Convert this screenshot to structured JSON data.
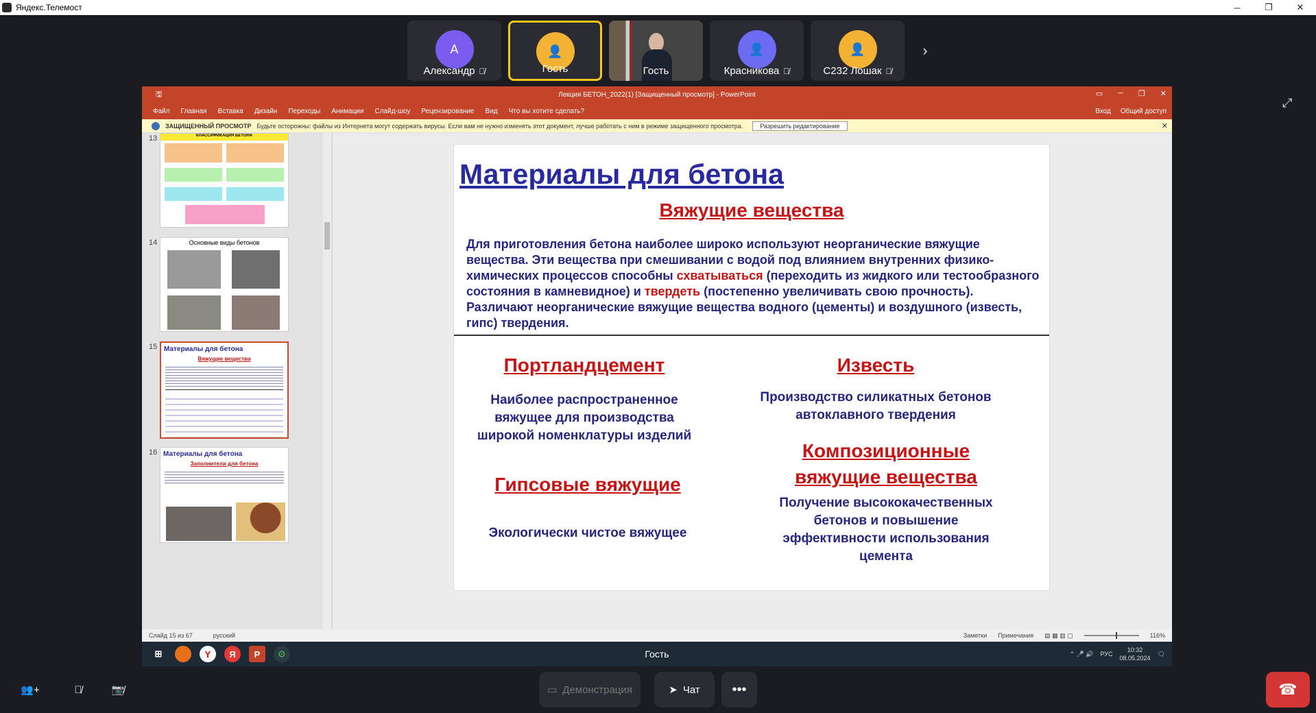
{
  "window": {
    "title": "Яндекс.Телемост"
  },
  "participants": [
    {
      "name": "Александр",
      "initial": "А",
      "color": "#7a5cf0",
      "muted": true
    },
    {
      "name": "Гость",
      "initial": "",
      "color": "#f3b233",
      "muted": false,
      "active": true
    },
    {
      "name": "Гость",
      "initial": "",
      "color": "",
      "muted": false,
      "video": true
    },
    {
      "name": "Красникова",
      "initial": "",
      "color": "#6b6cf2",
      "muted": true
    },
    {
      "name": "С232 Лошак",
      "initial": "",
      "color": "#f3b233",
      "muted": true
    }
  ],
  "ppt": {
    "doc_title": "Лекция БЕТОН_2022(1) [Защищенный просмотр] - PowerPoint",
    "menu": [
      "Файл",
      "Главная",
      "Вставка",
      "Дизайн",
      "Переходы",
      "Анимации",
      "Слайд-шоу",
      "Рецензирование",
      "Вид",
      "Что вы хотите сделать?"
    ],
    "login": "Вход",
    "share": "Общий доступ",
    "warning_bold": "ЗАЩИЩЕННЫЙ ПРОСМОТР",
    "warning_text": "Будьте осторожны: файлы из Интернета могут содержать вирусы. Если вам не нужно изменять этот документ, лучше работать с ним в режиме защищенного просмотра.",
    "warning_button": "Разрешить редактирование",
    "thumbs": [
      {
        "num": "13",
        "title": "КЛАССИФИКАЦИЯ БЕТОНА"
      },
      {
        "num": "14",
        "title": "Основные виды бетонов"
      },
      {
        "num": "15",
        "title": "Материалы для бетона",
        "sub": "Вяжущие вещества"
      },
      {
        "num": "16",
        "title": "Материалы для бетона",
        "sub": "Заполнители для бетона"
      }
    ],
    "status": {
      "slide": "Слайд 15 из 67",
      "lang": "русский",
      "notes": "Заметки",
      "comments": "Примечания",
      "zoom": "116%"
    }
  },
  "slide": {
    "title": "Материалы для бетона",
    "subtitle": "Вяжущие вещества",
    "para_1": "Для приготовления бетона наиболее широко используют неорганические вяжущие вещества. Эти вещества при смешивании с водой под влиянием внутренних физико-химических процессов способны ",
    "para_red_1": "схватываться",
    "para_2": " (переходить из жидкого или тестообразного состояния в камневидное) и ",
    "para_red_2": "твердеть",
    "para_3": " (постепенно увеличивать свою прочность). Различают неорганические вяжущие вещества водного (цементы) и воздушного (известь, гипс) твердения.",
    "portland_head": "Портландцемент",
    "portland_text": "Наиболее распространенное вяжущее для производства широкой номенклатуры изделий",
    "lime_head": "Известь",
    "lime_text": "Производство силикатных бетонов автоклавного твердения",
    "gypsum_head": "Гипсовые вяжущие",
    "gypsum_text": "Экологически чистое вяжущее",
    "comp_head": "Композиционные вяжущие вещества",
    "comp_text": "Получение высококачественных бетонов и повышение эффективности использования цемента"
  },
  "taskbar": {
    "center": "Гость",
    "lang": "РУС",
    "time": "10:32",
    "date": "08.05.2024"
  },
  "bottom": {
    "demo": "Демонстрация",
    "chat": "Чат"
  }
}
